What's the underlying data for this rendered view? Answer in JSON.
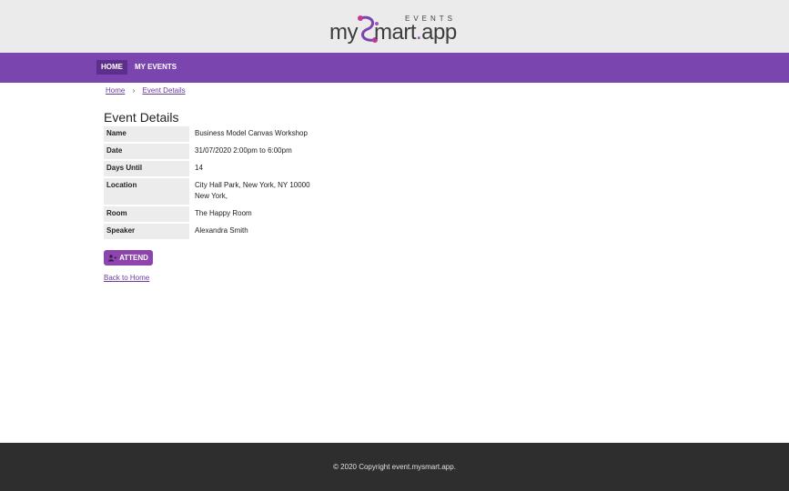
{
  "header": {
    "logo": {
      "brand_text": "my",
      "brand_rest": "mart",
      "brand_dot": ".",
      "brand_tld": "app",
      "events_label": "EVENTS"
    }
  },
  "nav": {
    "home_label": "HOME",
    "my_events_label": "MY EVENTS"
  },
  "breadcrumb": {
    "home": "Home",
    "separator": "›",
    "current": "Event Details"
  },
  "page": {
    "title": "Event Details"
  },
  "details": {
    "name_label": "Name",
    "name_value": "Business Model Canvas Workshop",
    "date_label": "Date",
    "date_value": "31/07/2020 2:00pm to 6:00pm",
    "days_label": "Days Until",
    "days_value": "14",
    "location_label": "Location",
    "location_line1": "City Hall Park, New York, NY 10000",
    "location_line2": "New York,",
    "room_label": "Room",
    "room_value": "The Happy Room",
    "speaker_label": "Speaker",
    "speaker_value": "Alexandra Smith"
  },
  "actions": {
    "attend_label": "ATTEND",
    "attend_icon": "user-plus-icon",
    "back_label": "Back to Home"
  },
  "footer": {
    "copyright": "© 2020 Copyright event.mysmart.app."
  },
  "colors": {
    "nav_bg": "#7b45b0",
    "accent": "#8e44ad",
    "footer_bg": "#2e2e2e",
    "header_bg": "#ebebeb"
  }
}
